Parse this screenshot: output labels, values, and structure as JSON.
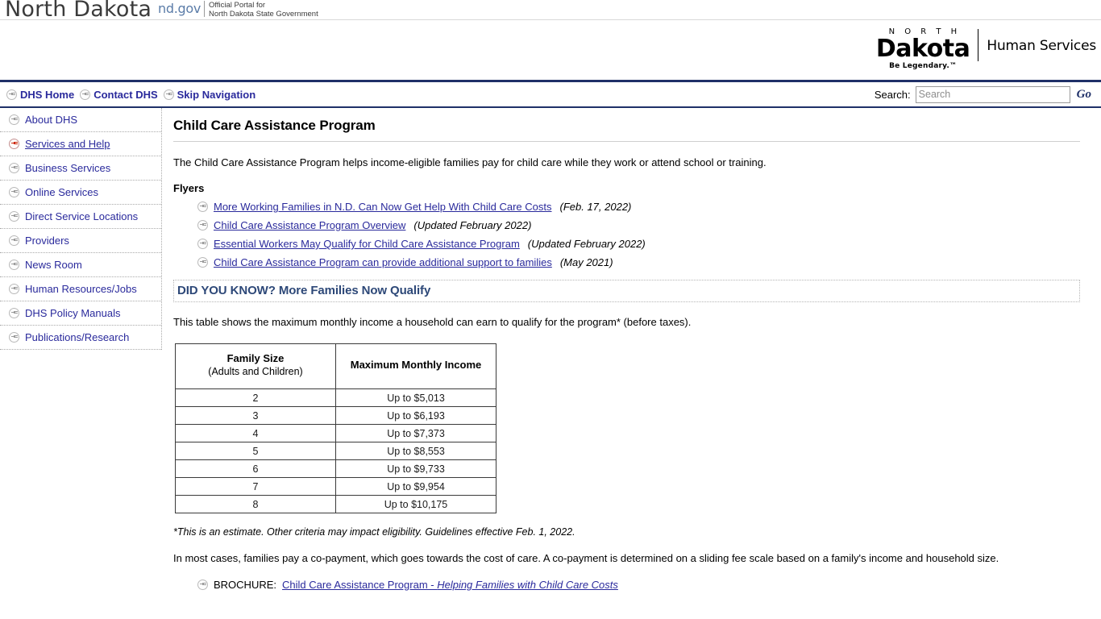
{
  "state_banner": {
    "wordmark": "North Dakota",
    "ndgov_logo": "nd.gov",
    "tagline_line1": "Official Portal for",
    "tagline_line2": "North Dakota State Government"
  },
  "agency_header": {
    "logo_north": "N O R T H",
    "logo_dakota": "Dakota",
    "logo_tagline": "Be Legendary.™",
    "logo_division": "Human Services"
  },
  "utility_nav": {
    "links": [
      {
        "label": "DHS Home",
        "icon": "circle-arrow-icon"
      },
      {
        "label": "Contact DHS",
        "icon": "circle-arrow-icon"
      },
      {
        "label": "Skip Navigation",
        "icon": "circle-arrow-icon"
      }
    ],
    "search_label": "Search:",
    "search_value": "",
    "search_placeholder": "Search",
    "search_button": "Go"
  },
  "sidebar": {
    "items": [
      {
        "label": "About DHS",
        "active": false
      },
      {
        "label": "Services and Help",
        "active": true
      },
      {
        "label": "Business Services",
        "active": false
      },
      {
        "label": "Online Services",
        "active": false
      },
      {
        "label": "Direct Service Locations",
        "active": false
      },
      {
        "label": "Providers",
        "active": false
      },
      {
        "label": "News Room",
        "active": false
      },
      {
        "label": "Human Resources/Jobs",
        "active": false
      },
      {
        "label": "DHS Policy Manuals",
        "active": false
      },
      {
        "label": "Publications/Research",
        "active": false
      }
    ]
  },
  "main": {
    "page_title": "Child Care Assistance Program",
    "intro": "The Child Care Assistance Program helps income-eligible families pay for child care while they work or attend school or training.",
    "flyers_heading": "Flyers",
    "flyers": [
      {
        "link": "More Working Families in N.D. Can Now Get Help With Child Care Costs",
        "date": "(Feb. 17, 2022)"
      },
      {
        "link": "Child Care Assistance Program Overview",
        "date": "(Updated February 2022)"
      },
      {
        "link": "Essential Workers May Qualify for Child Care Assistance Program",
        "date": "(Updated February 2022)"
      },
      {
        "link": "Child Care Assistance Program can provide additional support to families",
        "date": "(May 2021)"
      }
    ],
    "didyouknow_heading": "DID YOU KNOW? More Families Now Qualify",
    "table_intro": "This table shows the maximum monthly income a household can earn to qualify for the program* (before taxes).",
    "income_table": {
      "header_1_main": "Family Size",
      "header_1_sub": "(Adults and Children)",
      "header_2": "Maximum Monthly Income",
      "rows": [
        {
          "family_size": "2",
          "max_income": "Up to $5,013"
        },
        {
          "family_size": "3",
          "max_income": "Up to $6,193"
        },
        {
          "family_size": "4",
          "max_income": "Up to $7,373"
        },
        {
          "family_size": "5",
          "max_income": "Up to $8,553"
        },
        {
          "family_size": "6",
          "max_income": "Up to $9,733"
        },
        {
          "family_size": "7",
          "max_income": "Up to $9,954"
        },
        {
          "family_size": "8",
          "max_income": "Up to $10,175"
        }
      ]
    },
    "footnote": "*This is an estimate.  Other criteria may impact eligibility. Guidelines effective Feb. 1, 2022.",
    "copay_paragraph": "In most cases, families pay a co-payment, which goes towards the cost of care. A co-payment is determined on a sliding fee scale based on a family's income and household size.",
    "brochure": {
      "label": "BROCHURE:",
      "link_plain": "Child Care Assistance Program - ",
      "link_italic": "Helping Families with Child Care Costs"
    }
  },
  "colors": {
    "link": "#2a2a9c",
    "navy_rule": "#1f3068",
    "heading_blue": "#2d4878",
    "active_bullet": "#cc2200"
  }
}
